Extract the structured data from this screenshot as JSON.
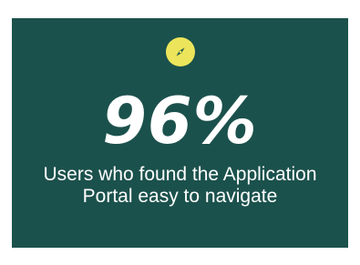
{
  "stat": {
    "value": "96%",
    "caption": "Users who found the Application Portal easy to navigate"
  },
  "icon": {
    "name": "compass-icon",
    "badge_color": "#ece55b",
    "card_color": "#1b514c"
  }
}
